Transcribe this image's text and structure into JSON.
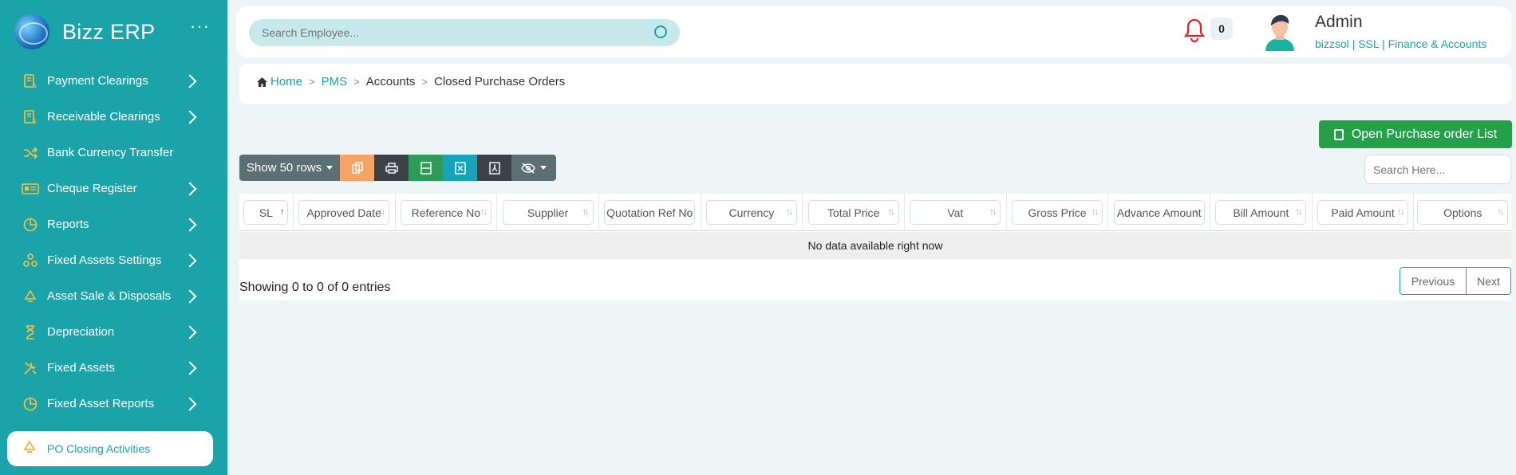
{
  "app": {
    "brand": "Bizz ERP",
    "more_icon": "ellipsis-icon"
  },
  "sidebar": {
    "items": [
      {
        "label": "Payment Clearings",
        "icon": "receipt-dollar-icon",
        "chevron": true
      },
      {
        "label": "Receivable Clearings",
        "icon": "receipt-dollar-icon",
        "chevron": true
      },
      {
        "label": "Bank Currency Transfer",
        "icon": "shuffle-icon",
        "chevron": false
      },
      {
        "label": "Cheque Register",
        "icon": "id-card-icon",
        "chevron": true
      },
      {
        "label": "Reports",
        "icon": "pie-chart-icon",
        "chevron": true
      },
      {
        "label": "Fixed Assets Settings",
        "icon": "shapes-icon",
        "chevron": true
      },
      {
        "label": "Asset Sale & Disposals",
        "icon": "recycle-icon",
        "chevron": true
      },
      {
        "label": "Depreciation",
        "icon": "hourglass-icon",
        "chevron": true
      },
      {
        "label": "Fixed Assets",
        "icon": "tools-icon",
        "chevron": true
      },
      {
        "label": "Fixed Asset Reports",
        "icon": "pie-chart-icon",
        "chevron": true
      }
    ],
    "active": {
      "label": "PO Closing Activities",
      "icon": "recycle-icon"
    }
  },
  "topbar": {
    "search_placeholder": "Search Employee...",
    "notification_count": "0",
    "user_name": "Admin",
    "user_subtitle": "bizzsol | SSL  | Finance & Accounts"
  },
  "breadcrumb": {
    "home": "Home",
    "items": [
      "PMS",
      "Accounts",
      "Closed Purchase Orders"
    ]
  },
  "actions": {
    "open_po_label": "Open Purchase order List"
  },
  "toolbar": {
    "show_rows": "Show 50 rows",
    "search_placeholder": "Search Here..."
  },
  "table": {
    "columns": [
      "SL",
      "Approved Date",
      "Reference No",
      "Supplier",
      "Quotation Ref No",
      "Currency",
      "Total Price",
      "Vat",
      "Gross Price",
      "Advance Amount",
      "Bill Amount",
      "Paid Amount",
      "Options"
    ],
    "empty_message": "No data available right now",
    "entries_info": "Showing 0 to 0 of 0 entries"
  },
  "pagination": {
    "previous": "Previous",
    "next": "Next"
  },
  "colors": {
    "primary": "#1aa3a8",
    "success": "#24a148",
    "icon_yellow": "#f6c343",
    "bell_red": "#e02020"
  }
}
